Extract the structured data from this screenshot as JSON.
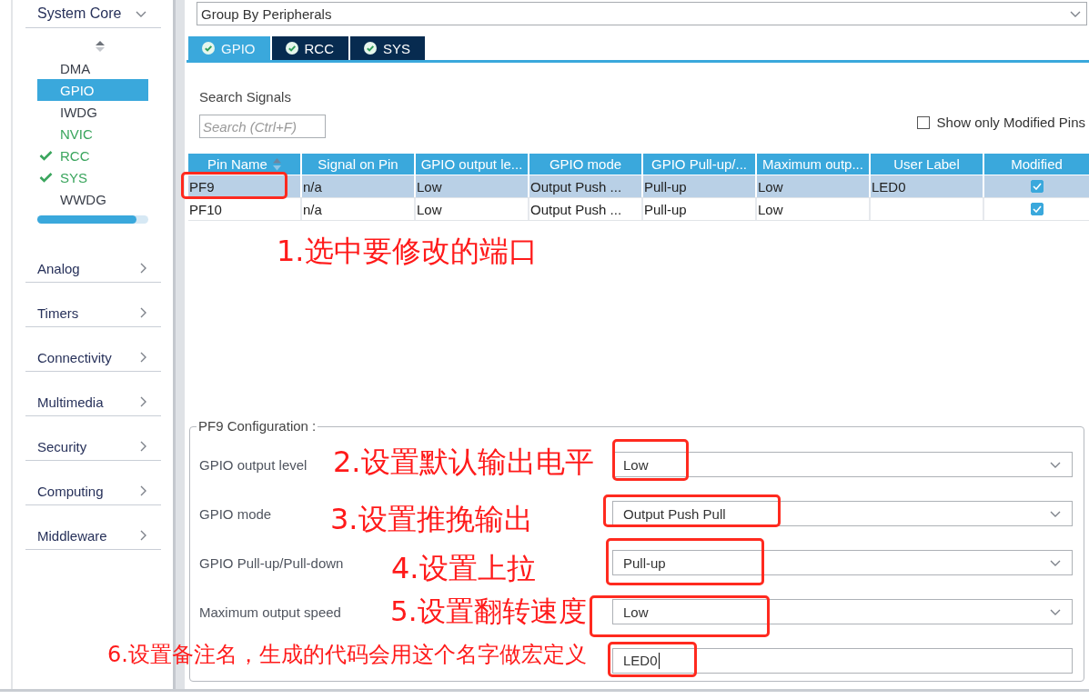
{
  "sidebar": {
    "categories": [
      {
        "label": "System Core",
        "expanded": true,
        "items": [
          {
            "label": "DMA",
            "selected": false,
            "active": false,
            "checked": false
          },
          {
            "label": "GPIO",
            "selected": true,
            "active": false,
            "checked": false
          },
          {
            "label": "IWDG",
            "selected": false,
            "active": false,
            "checked": false
          },
          {
            "label": "NVIC",
            "selected": false,
            "active": true,
            "checked": false
          },
          {
            "label": "RCC",
            "selected": false,
            "active": true,
            "checked": true
          },
          {
            "label": "SYS",
            "selected": false,
            "active": true,
            "checked": true
          },
          {
            "label": "WWDG",
            "selected": false,
            "active": false,
            "checked": false
          }
        ]
      },
      {
        "label": "Analog",
        "expanded": false
      },
      {
        "label": "Timers",
        "expanded": false
      },
      {
        "label": "Connectivity",
        "expanded": false
      },
      {
        "label": "Multimedia",
        "expanded": false
      },
      {
        "label": "Security",
        "expanded": false
      },
      {
        "label": "Computing",
        "expanded": false
      },
      {
        "label": "Middleware",
        "expanded": false
      }
    ]
  },
  "main": {
    "group_by": {
      "value": "Group By Peripherals"
    },
    "tabs": [
      {
        "label": "GPIO",
        "selected": true
      },
      {
        "label": "RCC",
        "selected": false
      },
      {
        "label": "SYS",
        "selected": false
      }
    ],
    "search": {
      "label": "Search Signals",
      "placeholder": "Search (Ctrl+F)"
    },
    "modified_filter": {
      "label": "Show only Modified Pins",
      "checked": false
    },
    "table": {
      "columns": [
        {
          "label": "Pin Name",
          "sorted": true
        },
        {
          "label": "Signal on Pin",
          "sorted": false
        },
        {
          "label": "GPIO output le...",
          "sorted": false
        },
        {
          "label": "GPIO mode",
          "sorted": false
        },
        {
          "label": "GPIO Pull-up/...",
          "sorted": false
        },
        {
          "label": "Maximum outp...",
          "sorted": false
        },
        {
          "label": "User Label",
          "sorted": false
        },
        {
          "label": "Modified",
          "sorted": false
        }
      ],
      "rows": [
        {
          "selected": true,
          "modified": true,
          "pin": "PF9",
          "signal": "n/a",
          "output_level": "Low",
          "mode": "Output Push ...",
          "pull": "Pull-up",
          "max_speed": "Low",
          "user_label": "LED0"
        },
        {
          "selected": false,
          "modified": true,
          "pin": "PF10",
          "signal": "n/a",
          "output_level": "Low",
          "mode": "Output Push ...",
          "pull": "Pull-up",
          "max_speed": "Low"
        }
      ]
    },
    "config": {
      "title": "PF9 Configuration :",
      "fields": [
        {
          "kind": "select",
          "label": "GPIO output level",
          "value": "Low"
        },
        {
          "kind": "select",
          "label": "GPIO mode",
          "value": "Output Push Pull"
        },
        {
          "kind": "select",
          "label": "GPIO Pull-up/Pull-down",
          "value": "Pull-up"
        },
        {
          "kind": "select",
          "label": "Maximum output speed",
          "value": "Low"
        },
        {
          "kind": "text",
          "value": "LED0"
        }
      ]
    }
  },
  "annotations": [
    {
      "text": "1.选中要修改的端口"
    },
    {
      "text": "2.设置默认输出电平"
    },
    {
      "text": "3.设置推挽输出"
    },
    {
      "text": "4.设置上拉"
    },
    {
      "text": "5.设置翻转速度"
    },
    {
      "text": "6.设置备注名，生成的代码会用这个名字做宏定义"
    }
  ]
}
